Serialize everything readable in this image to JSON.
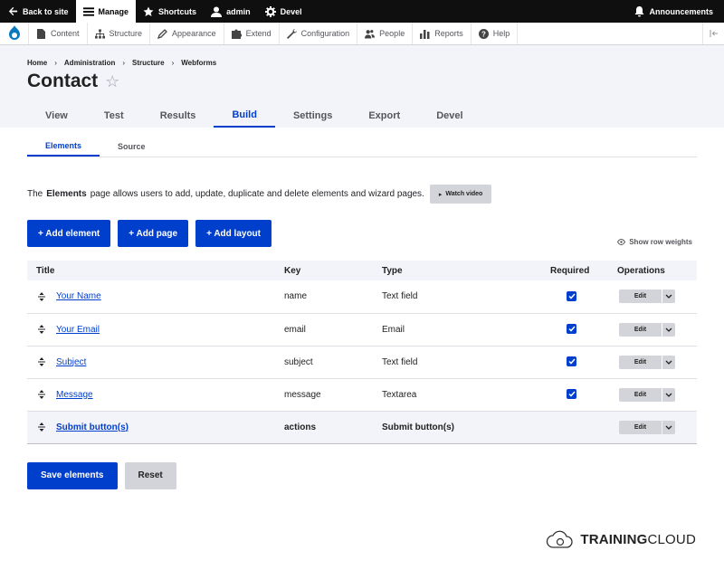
{
  "toolbar": {
    "back_label": "Back to site",
    "manage_label": "Manage",
    "shortcuts_label": "Shortcuts",
    "user_label": "admin",
    "devel_label": "Devel",
    "announcements_label": "Announcements"
  },
  "tray": {
    "items": [
      {
        "label": "Content",
        "icon": "file-icon"
      },
      {
        "label": "Structure",
        "icon": "sitemap-icon"
      },
      {
        "label": "Appearance",
        "icon": "brush-icon"
      },
      {
        "label": "Extend",
        "icon": "puzzle-icon"
      },
      {
        "label": "Configuration",
        "icon": "wrench-icon"
      },
      {
        "label": "People",
        "icon": "people-icon"
      },
      {
        "label": "Reports",
        "icon": "bar-chart-icon"
      },
      {
        "label": "Help",
        "icon": "question-icon"
      }
    ]
  },
  "breadcrumb": [
    "Home",
    "Administration",
    "Structure",
    "Webforms"
  ],
  "breadcrumb_sep": "›",
  "page_title": "Contact",
  "primary_tabs": [
    "View",
    "Test",
    "Results",
    "Build",
    "Settings",
    "Export",
    "Devel"
  ],
  "primary_active": "Build",
  "secondary_tabs": [
    "Elements",
    "Source"
  ],
  "secondary_active": "Elements",
  "description": {
    "pre": "The",
    "bold": "Elements",
    "post": "page allows users to add, update, duplicate and delete elements and wizard pages.",
    "watch_label": "Watch video"
  },
  "add_buttons": {
    "element": "+ Add element",
    "page": "+ Add page",
    "layout": "+ Add layout"
  },
  "row_weights_label": "Show row weights",
  "table": {
    "headers": {
      "title": "Title",
      "key": "Key",
      "type": "Type",
      "required": "Required",
      "operations": "Operations"
    },
    "rows": [
      {
        "title": "Your Name",
        "key": "name",
        "type": "Text field",
        "required": true
      },
      {
        "title": "Your Email",
        "key": "email",
        "type": "Email",
        "required": true
      },
      {
        "title": "Subject",
        "key": "subject",
        "type": "Text field",
        "required": true
      },
      {
        "title": "Message",
        "key": "message",
        "type": "Textarea",
        "required": true
      },
      {
        "title": "Submit button(s)",
        "key": "actions",
        "type": "Submit button(s)",
        "required": false
      }
    ],
    "edit_label": "Edit"
  },
  "form_actions": {
    "save": "Save elements",
    "reset": "Reset"
  },
  "brand": {
    "bold": "TRAINING",
    "rest": "CLOUD"
  },
  "colors": {
    "accent": "#003ecc",
    "toolbar_bg": "#0f0f0f",
    "header_bg": "#f3f4f9"
  }
}
